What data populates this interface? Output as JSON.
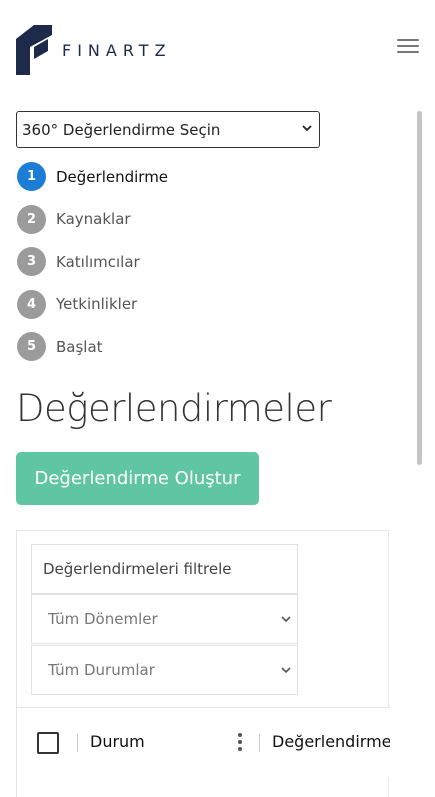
{
  "header": {
    "logo_text": "FINARTZ",
    "logo_icon": "finartz-logo-icon",
    "menu_icon": "hamburger-menu-icon"
  },
  "selector": {
    "value": "360° Değerlendirme Seçin"
  },
  "steps": [
    {
      "num": "1",
      "label": "Değerlendirme",
      "active": true
    },
    {
      "num": "2",
      "label": "Kaynaklar",
      "active": false
    },
    {
      "num": "3",
      "label": "Katılımcılar",
      "active": false
    },
    {
      "num": "4",
      "label": "Yetkinlikler",
      "active": false
    },
    {
      "num": "5",
      "label": "Başlat",
      "active": false
    }
  ],
  "main": {
    "title": "Değerlendirmeler",
    "create_button": "Değerlendirme Oluştur"
  },
  "filters": {
    "search_placeholder": "Değerlendirmeleri filtrele",
    "period_select": "Tüm Dönemler",
    "status_select": "Tüm Durumlar"
  },
  "table": {
    "columns": [
      "Durum",
      "Değerlendirme"
    ]
  },
  "colors": {
    "active_step": "#1c7dd6",
    "inactive_step": "#9b9b9b",
    "create_button": "#5fc5a3",
    "logo": "#1d2a4a"
  }
}
